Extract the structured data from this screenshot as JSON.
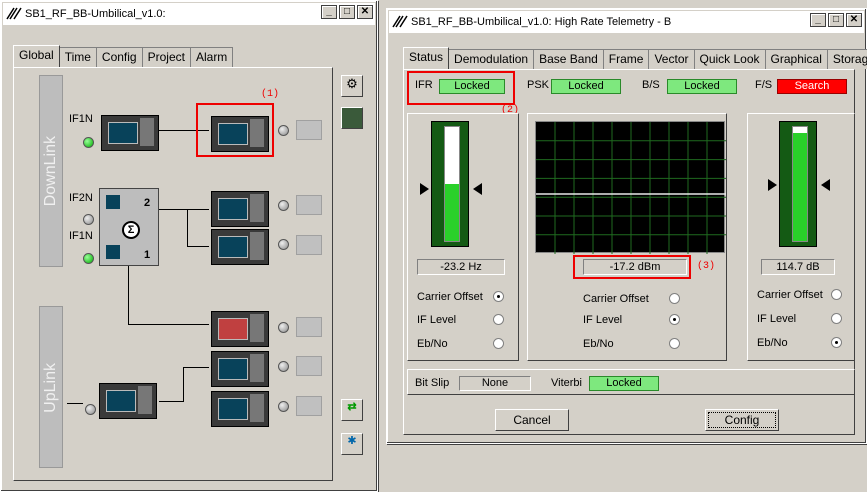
{
  "win1": {
    "title": "SB1_RF_BB-Umbilical_v1.0:",
    "tabs": [
      "Global",
      "Time",
      "Config",
      "Project",
      "Alarm"
    ],
    "downlink": "DownLink",
    "uplink": "UpLink",
    "if_labels": [
      "IF1N",
      "IF2N",
      "IF1N"
    ],
    "switch_ports": [
      "2",
      "1"
    ],
    "annotation": "(1)"
  },
  "win2": {
    "title": "SB1_RF_BB-Umbilical_v1.0: High Rate Telemetry - B",
    "tabs": [
      "Status",
      "Demodulation",
      "Base Band",
      "Frame",
      "Vector",
      "Quick Look",
      "Graphical",
      "Storage"
    ],
    "status": [
      {
        "label": "IFR",
        "value": "Locked",
        "color": "#7ee87e"
      },
      {
        "label": "PSK",
        "value": "Locked",
        "color": "#7ee87e"
      },
      {
        "label": "B/S",
        "value": "Locked",
        "color": "#7ee87e"
      },
      {
        "label": "F/S",
        "value": "Search",
        "color": "#ff0000"
      }
    ],
    "ann2": "(2)",
    "ann3": "(3)",
    "left_readout": "-23.2 Hz",
    "center_readout": "-17.2 dBm",
    "right_readout": "114.7 dB",
    "left_gauge_level": 0.5,
    "right_gauge_level": 0.95,
    "radio_labels": [
      "Carrier Offset",
      "IF Level",
      "Eb/No"
    ],
    "left_radio_selected": 0,
    "center_radio_selected": 1,
    "right_radio_selected": 2,
    "bit_slip_label": "Bit Slip",
    "bit_slip_value": "None",
    "viterbi_label": "Viterbi",
    "viterbi_value": "Locked",
    "cancel": "Cancel",
    "config": "Config"
  }
}
